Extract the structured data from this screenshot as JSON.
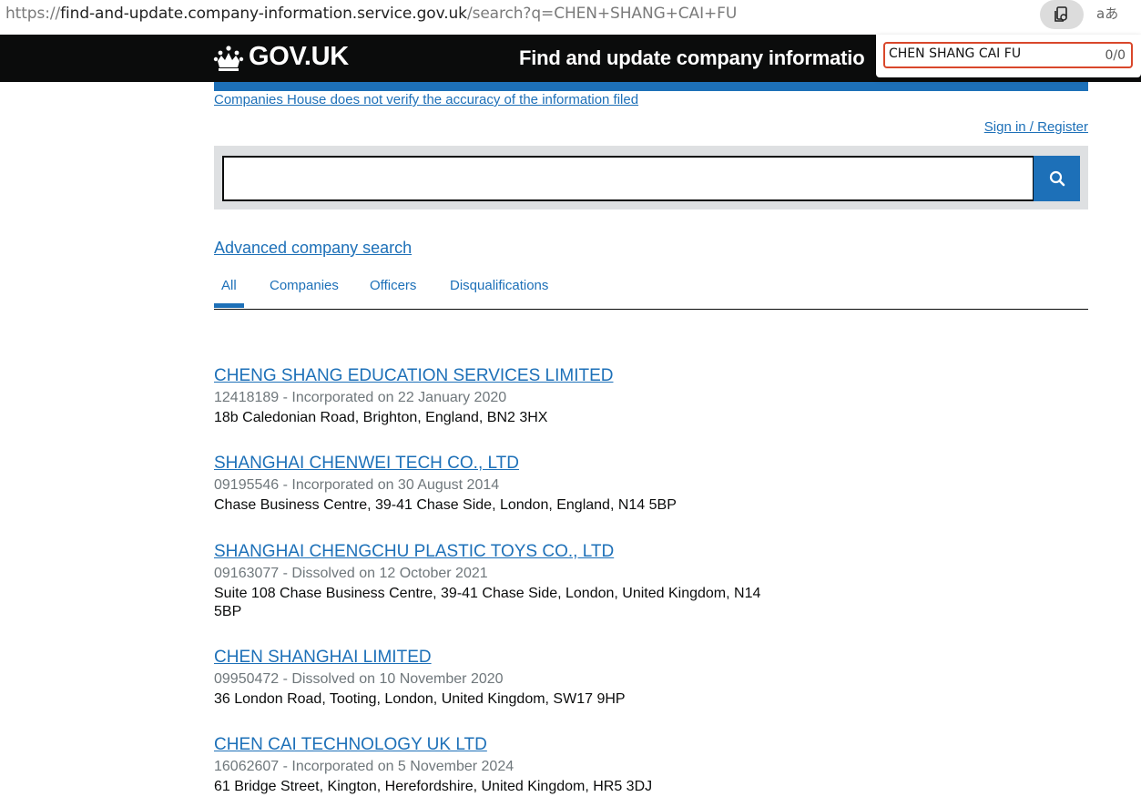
{
  "browser": {
    "url_scheme": "https://",
    "url_host": "find-and-update.company-information.service.gov.uk",
    "url_path": "/search?q=CHEN+SHANG+CAI+FU",
    "translate_label": "aあ"
  },
  "header": {
    "logo_text": "GOV.UK",
    "service_name": "Find and update company informatio",
    "bar_color": "#1d70b8"
  },
  "find_bar": {
    "query": "CHEN SHANG CAI FU",
    "count": "0/0"
  },
  "disclaimer": "Companies House does not verify the accuracy of the information filed",
  "sign_in": "Sign in / Register",
  "search": {
    "value": "",
    "icon": "search-icon"
  },
  "advanced_search": "Advanced company search",
  "tabs": [
    {
      "label": "All"
    },
    {
      "label": "Companies"
    },
    {
      "label": "Officers"
    },
    {
      "label": "Disqualifications"
    }
  ],
  "results": [
    {
      "title": "CHENG SHANG EDUCATION SERVICES LIMITED",
      "meta": "12418189 - Incorporated on 22 January 2020",
      "address": "18b Caledonian Road, Brighton, England, BN2 3HX"
    },
    {
      "title": "SHANGHAI CHENWEI TECH CO., LTD",
      "meta": "09195546 - Incorporated on 30 August 2014",
      "address": "Chase Business Centre, 39-41 Chase Side, London, England, N14 5BP"
    },
    {
      "title": "SHANGHAI CHENGCHU PLASTIC TOYS CO., LTD",
      "meta": "09163077 - Dissolved on 12 October 2021",
      "address": "Suite 108 Chase Business Centre, 39-41 Chase Side, London, United Kingdom, N14 5BP"
    },
    {
      "title": "CHEN SHANGHAI LIMITED",
      "meta": "09950472 - Dissolved on 10 November 2020",
      "address": "36 London Road, Tooting, London, United Kingdom, SW17 9HP"
    },
    {
      "title": "CHEN CAI TECHNOLOGY UK LTD",
      "meta": "16062607 - Incorporated on 5 November 2024",
      "address": "61 Bridge Street, Kington, Herefordshire, United Kingdom, HR5 3DJ"
    }
  ]
}
